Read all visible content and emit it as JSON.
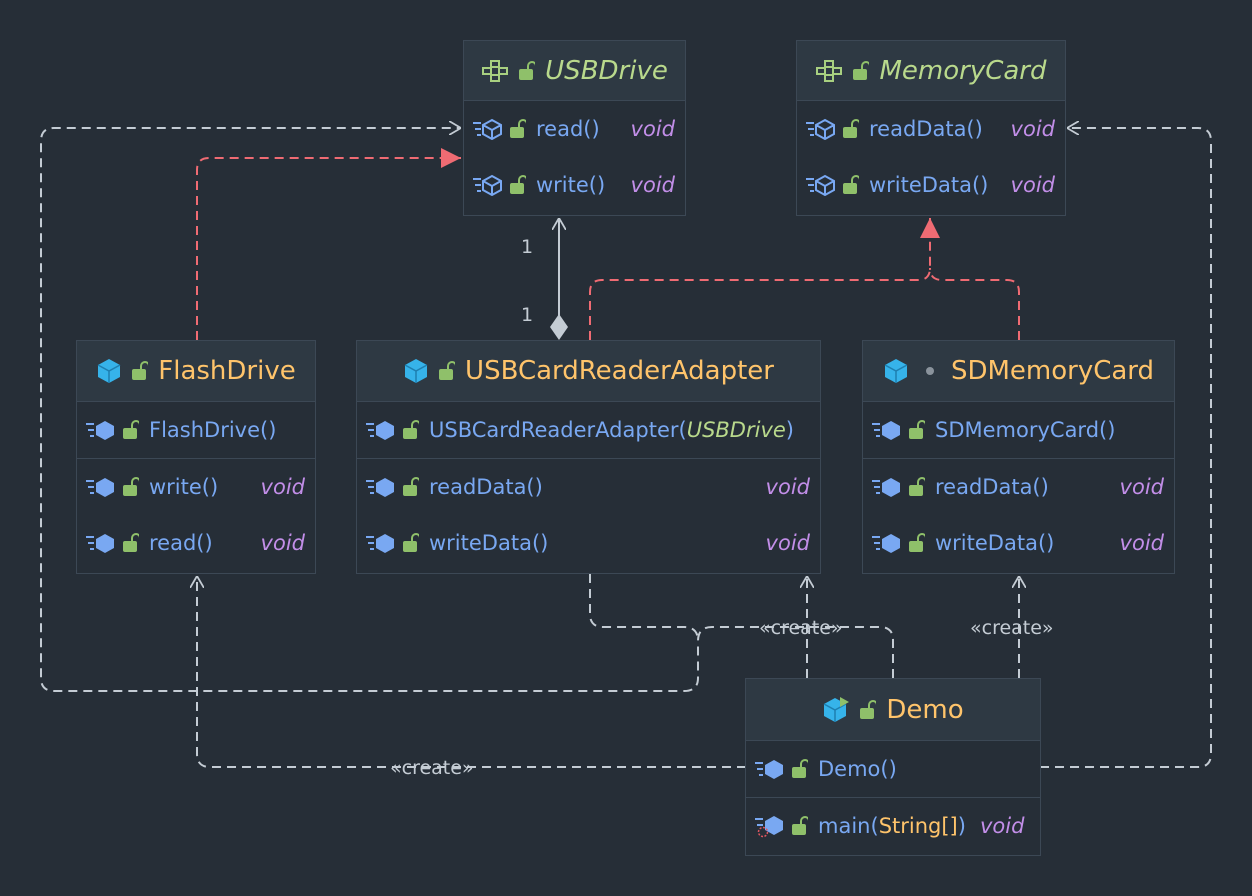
{
  "colors": {
    "background": "#262e37",
    "header": "#2e3943",
    "border": "#3c4855",
    "interface_title": "#b9d98c",
    "class_title": "#ffc46b",
    "member": "#79a8f2",
    "return_type": "#c28ee8",
    "dependency_edge": "#c4ccd4",
    "realization_edge": "#ef6b73",
    "class_icon": "#36b3ea",
    "lock_icon": "#8fc06a"
  },
  "nodes": {
    "usbdrive": {
      "title": "USBDrive",
      "members": [
        {
          "name": "read()",
          "ret": "void"
        },
        {
          "name": "write()",
          "ret": "void"
        }
      ]
    },
    "memorycard": {
      "title": "MemoryCard",
      "members": [
        {
          "name": "readData()",
          "ret": "void"
        },
        {
          "name": "writeData()",
          "ret": "void"
        }
      ]
    },
    "flashdrive": {
      "title": "FlashDrive",
      "constructor": "FlashDrive()",
      "methods": [
        {
          "name": "write()",
          "ret": "void"
        },
        {
          "name": "read()",
          "ret": "void"
        }
      ]
    },
    "adapter": {
      "title": "USBCardReaderAdapter",
      "constructor": "USBCardReaderAdapter",
      "constructor_param": "USBDrive",
      "methods": [
        {
          "name": "readData()",
          "ret": "void"
        },
        {
          "name": "writeData()",
          "ret": "void"
        }
      ]
    },
    "sdcard": {
      "title": "SDMemoryCard",
      "constructor": "SDMemoryCard()",
      "methods": [
        {
          "name": "readData()",
          "ret": "void"
        },
        {
          "name": "writeData()",
          "ret": "void"
        }
      ]
    },
    "demo": {
      "title": "Demo",
      "constructor": "Demo()",
      "main_name": "main",
      "main_param": "String[]",
      "main_ret": "void"
    }
  },
  "edge_labels": {
    "multiplicity_top": "1",
    "multiplicity_bottom": "1",
    "create_adapter": "«create»",
    "create_sdcard": "«create»",
    "create_flashdrive": "«create»"
  },
  "icons": {
    "interface": "interface-icon",
    "class": "class-icon",
    "main_class": "main-class-icon",
    "public": "lock-open-icon",
    "package_private": "package-dot-icon",
    "method": "method-icon",
    "constructor": "constructor-icon"
  }
}
